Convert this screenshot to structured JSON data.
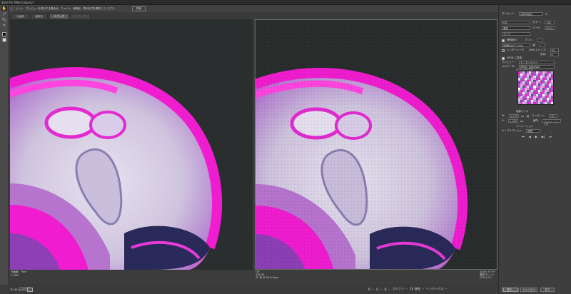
{
  "window": {
    "title": "Save for Web (Legacy)"
  },
  "infobar": {
    "text": "ヒント：プレビューを表示する場合は、ファイル、最適化、表示形式を選択してください",
    "button": "詳細"
  },
  "tabs": [
    {
      "label": "元画像",
      "state": "normal"
    },
    {
      "label": "最適化",
      "state": "normal"
    },
    {
      "label": "2 アップ",
      "state": "active"
    },
    {
      "label": "4 アップ",
      "state": "disabled"
    }
  ],
  "left_preview": {
    "line1": "元画像：\"bnr\"",
    "line2": "1.99M"
  },
  "right_preview": {
    "line1": "GIF",
    "line2": "166.2K",
    "line3": "32 秒 @ 56.6 Kbps",
    "right1": "100% ディザ",
    "right2": "選択パレット",
    "right3": "128 カラー"
  },
  "bottombar": {
    "zoom": "100%",
    "r": "R: --",
    "g": "G: --",
    "b": "B: --",
    "alpha": "アルファ: --",
    "hex": "16 進数: --",
    "index": "インデックス: --"
  },
  "bottom_buttons": {
    "preview": "プレビュー",
    "save": "保存...",
    "cancel": "キャンセル",
    "done": "完了"
  },
  "right_panel": {
    "preset_label": "プリセット：",
    "preset_value": "[名称未設定]",
    "format": "GIF",
    "reduction": "選択",
    "colors_label": "カラー：",
    "colors_value": "128",
    "dither_algo": "ディザ",
    "dither_label": "ディザ：",
    "dither_value": "100%",
    "transparency": "透明部分",
    "matte_label": "マット：",
    "no_transparency_dither": "透明部分のディザなし",
    "amount_label": "量：",
    "interlace": "インターレース",
    "web_snap_label": "Web スナップ：",
    "web_snap_value": "0%",
    "lossy_label": "劣化：",
    "lossy_value": "0",
    "convert_srgb": "sRGB に変換",
    "preview_label": "プレビュー：",
    "preview_value": "モニターカラー",
    "metadata_label": "メタデータ：",
    "metadata_value": "著作権と連絡先情報",
    "color_table_label": "カラーテーブル",
    "image_size_label": "画像サイズ",
    "w_label": "W：",
    "w_value": "1,000",
    "h_label": "H：",
    "h_value": "1,000",
    "px": "px",
    "percent_label": "パーセント：",
    "percent_value": "100",
    "quality_label": "画質：",
    "quality_value": "バイキュービック法",
    "animation_label": "アニメーション",
    "loop_label": "ループオプション：",
    "loop_value": "無限"
  },
  "palette": [
    "#f01dd0",
    "#e61ac8",
    "#d63fc9",
    "#c844c4",
    "#b86bd0",
    "#a85fc8",
    "#9a58c2",
    "#f7a6ea",
    "#ffffff",
    "#e8d8ee",
    "#d2c0e0",
    "#c6b2d8",
    "#b9a4ce",
    "#a998c4",
    "#7d6fa9",
    "#5a4e8a"
  ],
  "colors": {
    "accent": "#f01dd0",
    "bg": "#2b2e2e"
  }
}
